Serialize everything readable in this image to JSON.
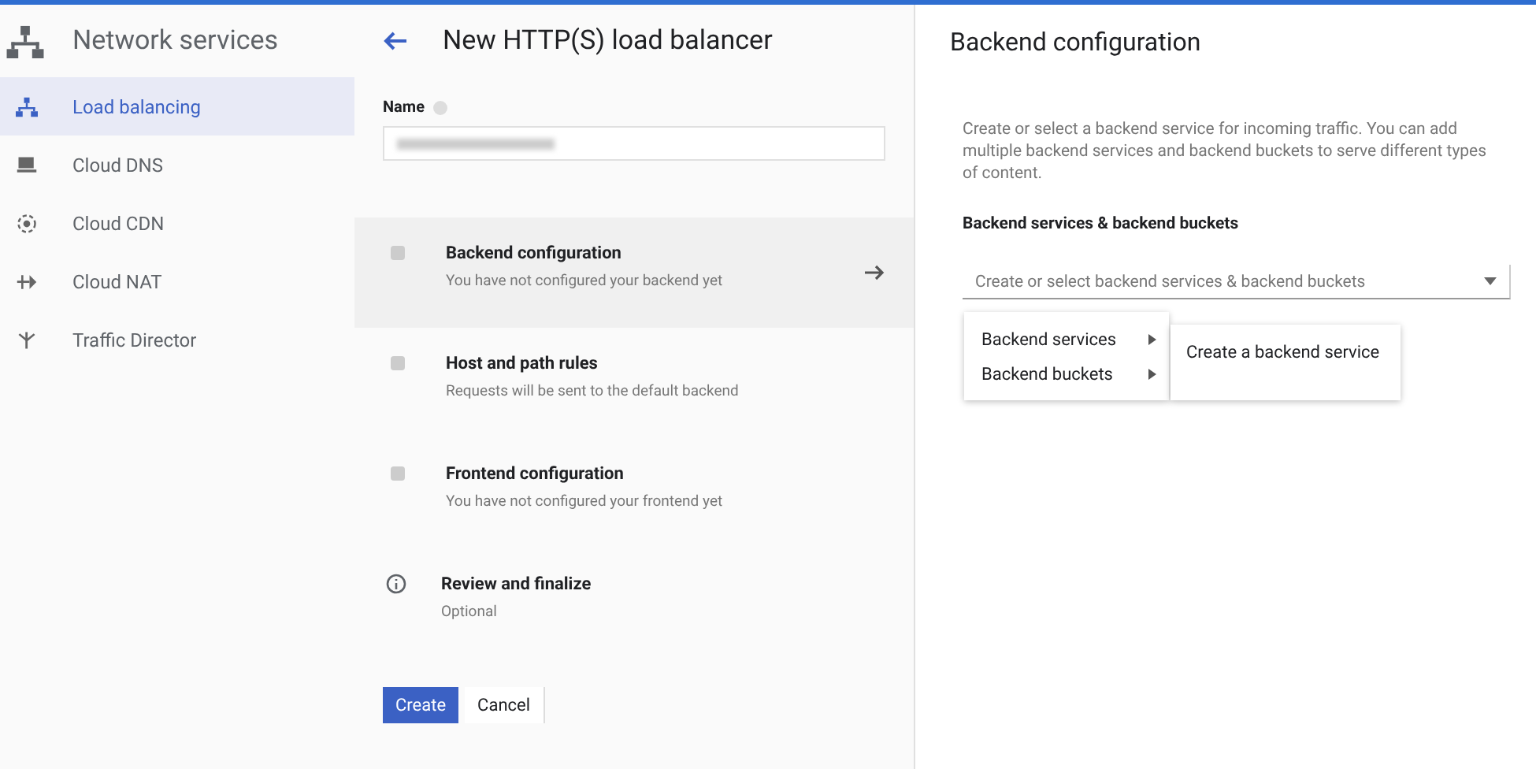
{
  "sidebar": {
    "title": "Network services",
    "items": [
      {
        "label": "Load balancing",
        "selected": true
      },
      {
        "label": "Cloud DNS",
        "selected": false
      },
      {
        "label": "Cloud CDN",
        "selected": false
      },
      {
        "label": "Cloud NAT",
        "selected": false
      },
      {
        "label": "Traffic Director",
        "selected": false
      }
    ]
  },
  "form": {
    "title": "New HTTP(S) load balancer",
    "name_label": "Name",
    "steps": [
      {
        "title": "Backend configuration",
        "subtitle": "You have not configured your backend yet",
        "kind": "required",
        "selected": true
      },
      {
        "title": "Host and path rules",
        "subtitle": "Requests will be sent to the default backend",
        "kind": "required",
        "selected": false
      },
      {
        "title": "Frontend configuration",
        "subtitle": "You have not configured your frontend yet",
        "kind": "required",
        "selected": false
      },
      {
        "title": "Review and finalize",
        "subtitle": "Optional",
        "kind": "optional",
        "selected": false
      }
    ],
    "buttons": [
      {
        "label": "Create",
        "kind": "primary"
      },
      {
        "label": "Cancel",
        "kind": "secondary"
      }
    ]
  },
  "panel": {
    "title": "Backend configuration",
    "description": "Create or select a backend service for incoming traffic. You can add multiple backend services and backend buckets to serve different types of content.",
    "field_label": "Backend services & backend buckets",
    "dropdown": {
      "placeholder": "Create or select backend services & backend buckets"
    },
    "menu": [
      "Backend services",
      "Backend buckets"
    ],
    "submenu": [
      "Create a backend service"
    ]
  }
}
